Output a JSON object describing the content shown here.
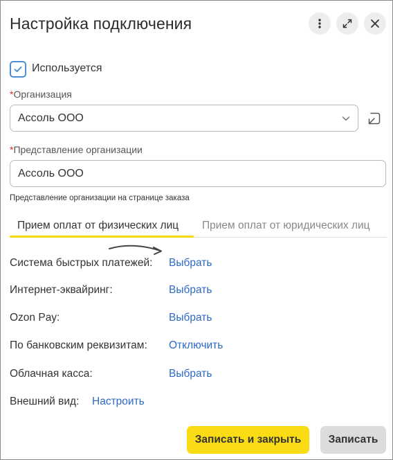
{
  "header": {
    "title": "Настройка подключения"
  },
  "used": {
    "label": "Используется",
    "checked": true
  },
  "organization": {
    "required_mark": "*",
    "label": "Организация",
    "value": "Ассоль ООО"
  },
  "org_view": {
    "required_mark": "*",
    "label": "Представление организации",
    "value": "Ассоль ООО",
    "hint": "Представление организации на странице заказа"
  },
  "tabs": [
    {
      "label": "Прием оплат от физических лиц",
      "active": true
    },
    {
      "label": "Прием оплат от юридических лиц",
      "active": false
    }
  ],
  "payment_rows": [
    {
      "label": "Система быстрых платежей:",
      "action": "Выбрать"
    },
    {
      "label": "Интернет-эквайринг:",
      "action": "Выбрать"
    },
    {
      "label": "Ozon Pay:",
      "action": "Выбрать"
    },
    {
      "label": "По банковским реквизитам:",
      "action": "Отключить"
    },
    {
      "label": "Облачная касса:",
      "action": "Выбрать"
    }
  ],
  "appearance": {
    "label": "Внешний вид:",
    "action": "Настроить"
  },
  "footer": {
    "save_close_label": "Записать и закрыть",
    "save_label": "Записать"
  },
  "colors": {
    "accent_yellow": "#f9dc14",
    "link_blue": "#2c6ac6",
    "checkbox_blue": "#4e8ed6",
    "required_red": "#d0302d"
  }
}
